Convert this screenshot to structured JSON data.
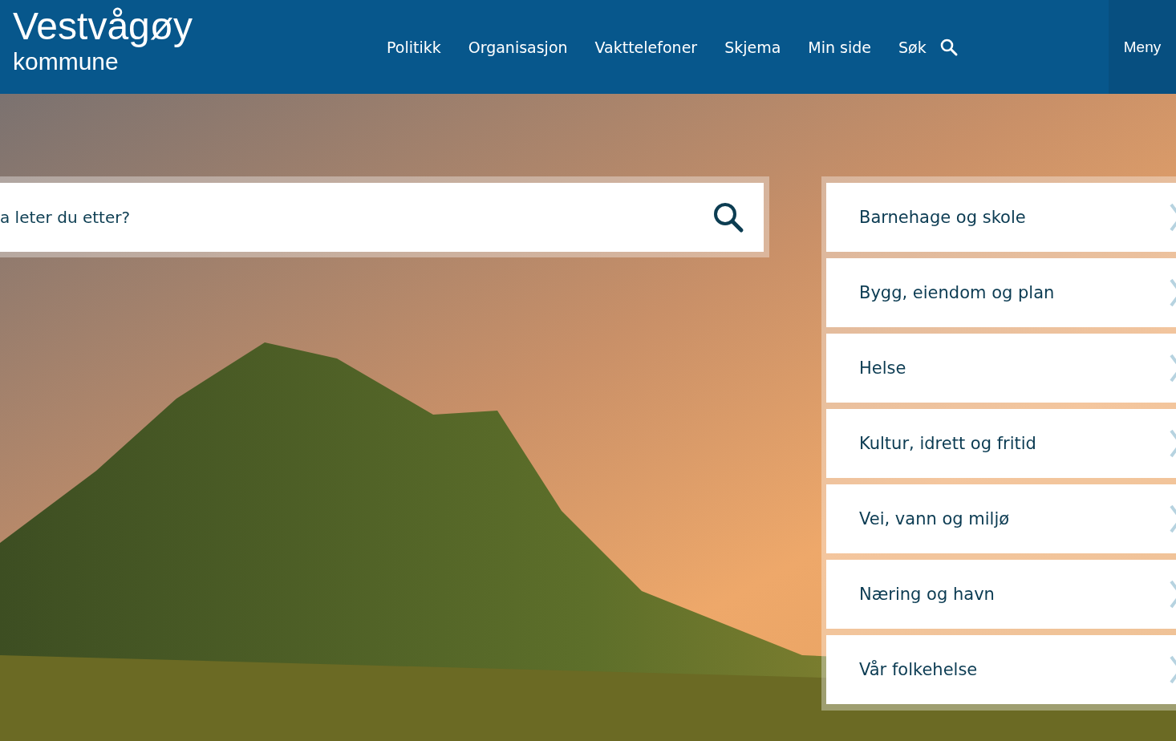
{
  "logo": {
    "name": "Vestvågøy",
    "subtitle": "kommune"
  },
  "nav": [
    {
      "label": "Politikk",
      "kind": "link"
    },
    {
      "label": "Organisasjon",
      "kind": "link"
    },
    {
      "label": "Vakttelefoner",
      "kind": "link"
    },
    {
      "label": "Skjema",
      "kind": "link"
    },
    {
      "label": "Min side",
      "kind": "link"
    },
    {
      "label": "Søk",
      "kind": "search"
    }
  ],
  "menu_button": "Meny",
  "search": {
    "placeholder": "a leter du etter?"
  },
  "categories": [
    "Barnehage og skole",
    "Bygg, eiendom og plan",
    "Helse",
    "Kultur, idrett og fritid",
    "Vei, vann og miljø",
    "Næring og havn",
    "Vår folkehelse"
  ]
}
